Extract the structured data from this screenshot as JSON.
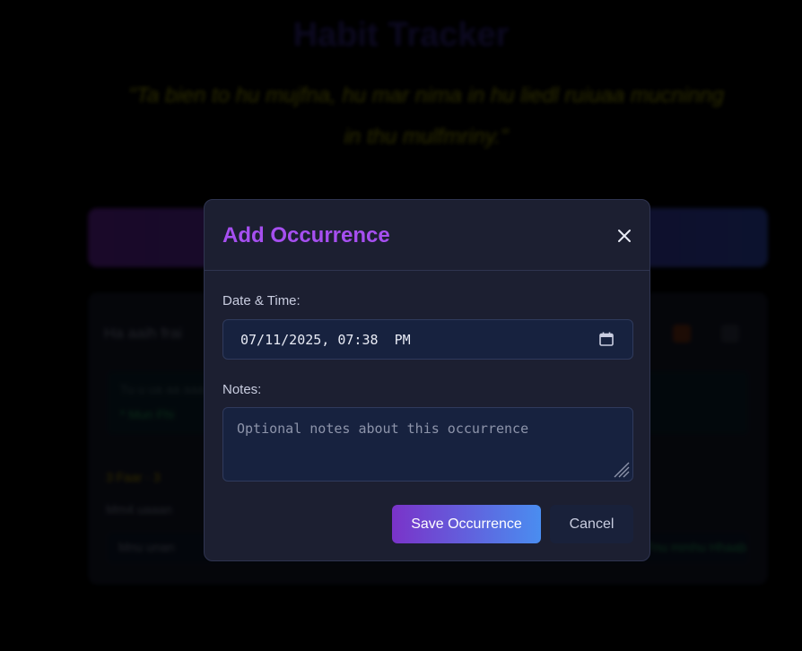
{
  "background": {
    "app_title": "Habit Tracker",
    "quote": "\"Ta bien to hu mujfna, hu mar nima in hu liedl ruiuaa mucninng in thu mulfmriny.\"",
    "card": {
      "title": "Ha aaih frai",
      "inner_line_1": "Tu u ua aa aaa",
      "inner_line_2": "* Mun Fhi",
      "stats": "3 Faar · 3",
      "sub": "Mm4 uaaan",
      "footer_left": "Mnu unan",
      "footer_right": "Fnu mmhu Hhaab"
    },
    "colors": {
      "title": "#3d2f9e",
      "quote": "#d4d400"
    }
  },
  "modal": {
    "title": "Add Occurrence",
    "close_icon": "close-icon",
    "date_label": "Date & Time:",
    "date_value": "07/11/2025, 07:38  PM",
    "calendar_icon": "calendar-icon",
    "notes_label": "Notes:",
    "notes_placeholder": "Optional notes about this occurrence",
    "notes_value": "",
    "save_label": "Save Occurrence",
    "cancel_label": "Cancel",
    "colors": {
      "accent": "#a64ff0",
      "save_gradient_start": "#7a33c9",
      "save_gradient_end": "#4a8df0",
      "surface": "#1c1f31",
      "input_bg": "#17223f"
    }
  }
}
